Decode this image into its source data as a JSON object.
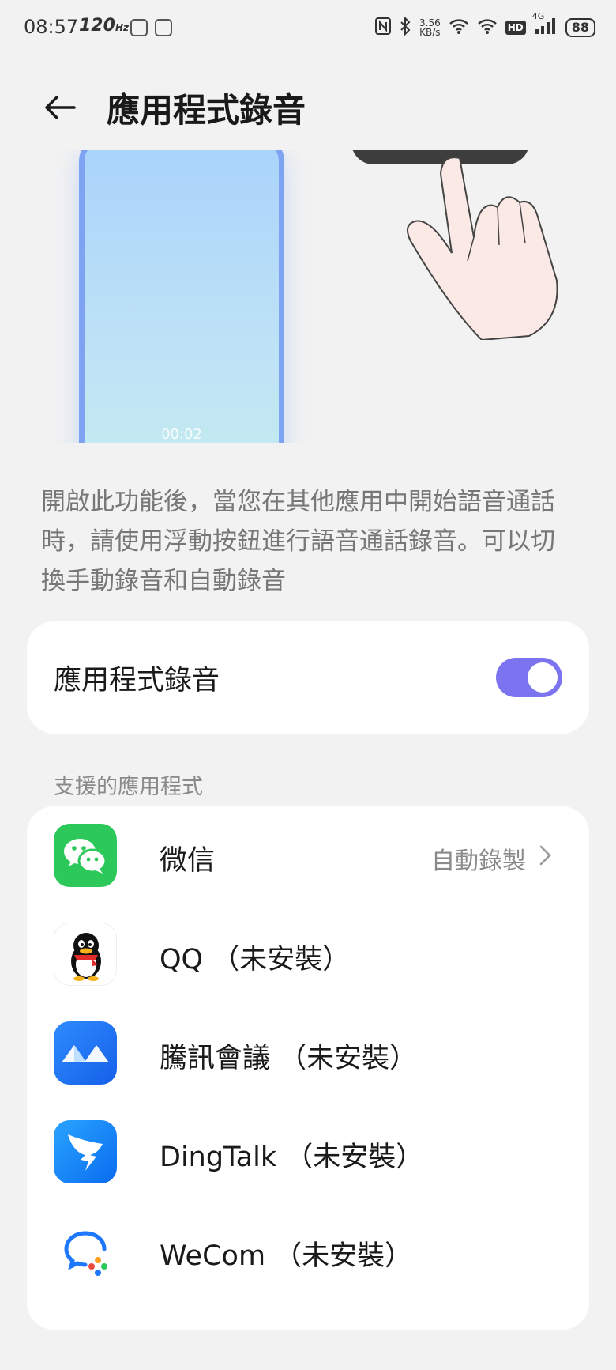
{
  "status_bar": {
    "time": "08:57",
    "refresh_rate": "120",
    "refresh_unit": "Hz",
    "speed_value": "3.56",
    "speed_unit": "KB/s",
    "hd_badge": "HD",
    "network": "4G",
    "battery": "88"
  },
  "header": {
    "title": "應用程式錄音"
  },
  "illustration": {
    "call_timer": "00:02"
  },
  "description": "開啟此功能後，當您在其他應用中開始語音通話時，請使用浮動按鈕進行語音通話錄音。可以切換手動錄音和自動錄音",
  "recording_toggle": {
    "label": "應用程式錄音",
    "enabled": true
  },
  "supported_section": {
    "label": "支援的應用程式",
    "apps": [
      {
        "name": "微信",
        "status": "自動錄製",
        "icon": "wechat-icon"
      },
      {
        "name": "QQ （未安裝）",
        "icon": "qq-icon"
      },
      {
        "name": "騰訊會議 （未安裝）",
        "icon": "tencent-meeting-icon"
      },
      {
        "name": "DingTalk （未安裝）",
        "icon": "dingtalk-icon"
      },
      {
        "name": "WeCom （未安裝）",
        "icon": "wecom-icon"
      }
    ]
  },
  "colors": {
    "accent": "#7b73f0",
    "background": "#f2f2f2",
    "card": "#ffffff",
    "secondary_text": "#8a8a8a"
  }
}
